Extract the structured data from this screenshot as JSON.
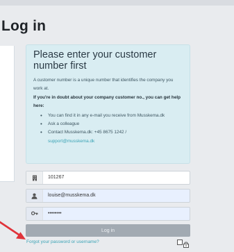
{
  "page": {
    "title": "Log in"
  },
  "info": {
    "heading": "Please enter your customer number first",
    "paragraph": "A customer number is a unique number that identifies the company you work at.",
    "bold": "If you're in doubt about your company customer no., you can get help here:",
    "items": [
      {
        "text": "You can find it in any e-mail you receive from Musskema.dk"
      },
      {
        "text": "Ask a colleague"
      },
      {
        "text": "Contact Musskema.dk: +45 8675 1242 /",
        "link": "support@musskema.dk"
      }
    ]
  },
  "form": {
    "customer_number": {
      "value": "101267",
      "icon": "building-icon"
    },
    "email": {
      "value": "louise@musskema.dk",
      "icon": "user-icon"
    },
    "password": {
      "value": "••••••••",
      "icon": "key-icon"
    },
    "login_label": "Log in",
    "forgot_label": "Forgot your password or username?"
  },
  "colors": {
    "info_bg": "#d9edf2",
    "link": "#3aa3b5",
    "button": "#a2aab2",
    "arrow": "#e0333a"
  }
}
